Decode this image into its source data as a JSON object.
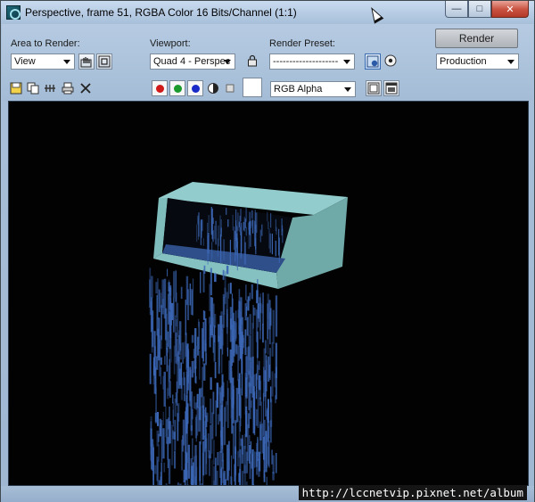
{
  "window": {
    "title": "Perspective, frame 51, RGBA Color 16 Bits/Channel (1:1)",
    "controls": {
      "minimize": "—",
      "maximize": "□",
      "close": "✕"
    }
  },
  "panel": {
    "area_to_render": {
      "label": "Area to Render:",
      "value": "View"
    },
    "viewport": {
      "label": "Viewport:",
      "value": "Quad 4 - Perspec"
    },
    "render_preset": {
      "label": "Render Preset:",
      "value": "--------------------"
    },
    "render_button": "Render",
    "render_mode": {
      "value": "Production"
    },
    "channel_display": {
      "value": "RGB Alpha"
    }
  },
  "icons": {
    "edit_region": "hand-region-icon",
    "auto_region": "auto-region-icon",
    "lock": "lock-icon",
    "environment": "environment-icon",
    "render_settings": "render-settings-icon",
    "save": "save-icon",
    "copy": "copy-icon",
    "clone": "clone-icon",
    "print": "print-icon",
    "clear": "clear-icon",
    "mono": "mono-icon",
    "single_channel": "single-channel-icon",
    "toggle_ui_overlay": "ui-overlay-icon",
    "toggle_ui": "ui-icon"
  },
  "colors": {
    "red_channel": "#d01a1a",
    "green_channel": "#1a9a2a",
    "blue_channel": "#1a2ac8",
    "swatch": "#ffffff",
    "viewport_bg": "#020202",
    "box_top": "#92cccc",
    "box_side": "#6fa9a8",
    "water": "#3b66b4"
  },
  "watermark": "http://lccnetvip.pixnet.net/album"
}
